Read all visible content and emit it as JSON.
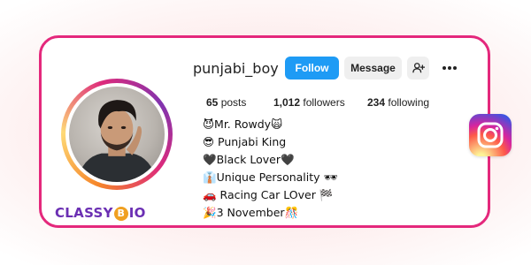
{
  "profile": {
    "username": "punjabi_boy",
    "follow_label": "Follow",
    "message_label": "Message",
    "stats": {
      "posts_count": "65",
      "posts_label": "posts",
      "followers_count": "1,012",
      "followers_label": "followers",
      "following_count": "234",
      "following_label": "following"
    },
    "bio": [
      "😈Mr. Rowdy🙀",
      "😎 Punjabi King",
      "🖤Black Lover🖤",
      "👔Unique Personality 🕶",
      "🚗 Racing Car LOver 🏁",
      "🎉3 November🎊"
    ]
  },
  "brand": {
    "prefix": "CLASSY",
    "b_letter": "B",
    "suffix": "IO"
  },
  "icons": {
    "add_user": "add-user-icon",
    "more": "more-horizontal-icon",
    "instagram": "instagram-logo-icon"
  },
  "colors": {
    "card_border": "#e4287c",
    "follow_button": "#1e9bf5",
    "secondary_button": "#efefef",
    "brand_text": "#6b2fb3"
  }
}
